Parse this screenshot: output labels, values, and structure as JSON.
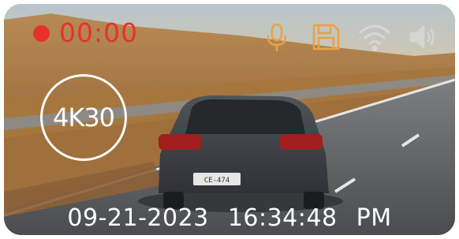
{
  "recording": {
    "time": "00:00",
    "color": "#e8302c"
  },
  "status_icons": [
    {
      "name": "microphone-icon",
      "color": "#e8a24a"
    },
    {
      "name": "save-icon",
      "color": "#e8a24a"
    },
    {
      "name": "wifi-icon",
      "color": "#d9dde0"
    },
    {
      "name": "volume-icon",
      "color": "#d9dde0"
    }
  ],
  "resolution_badge": {
    "label": "4K30"
  },
  "timestamp": {
    "date": "09-21-2023",
    "time": "16:34:48",
    "period": "PM"
  },
  "photo": {
    "plate": "CE-474"
  }
}
